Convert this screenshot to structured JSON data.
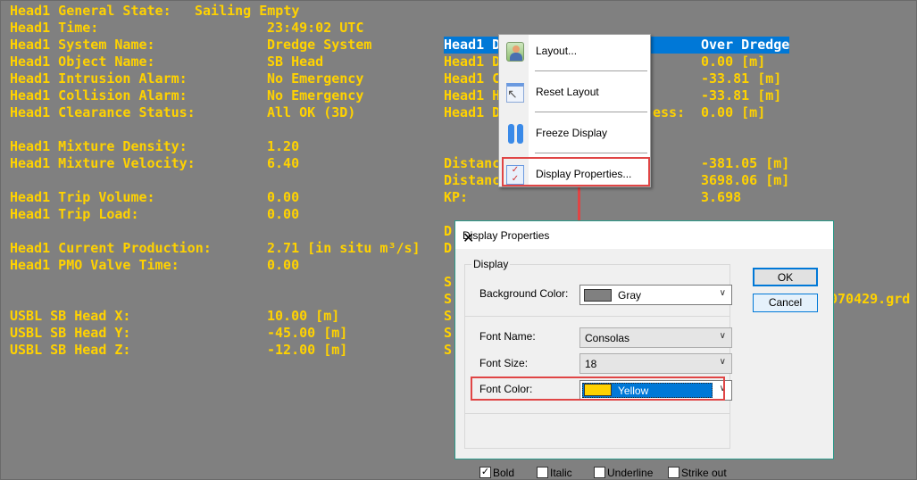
{
  "left_rows": [
    {
      "label": "Head1 General State:",
      "value": "Sailing Empty",
      "row": 0,
      "vcol": "near"
    },
    {
      "label": "Head1 Time:",
      "value": "23:49:02 UTC",
      "row": 1
    },
    {
      "label": "Head1 System Name:",
      "value": "Dredge System",
      "row": 2
    },
    {
      "label": "Head1 Object Name:",
      "value": "SB Head",
      "row": 3
    },
    {
      "label": "Head1 Intrusion Alarm:",
      "value": "No Emergency",
      "row": 4
    },
    {
      "label": "Head1 Collision Alarm:",
      "value": "No Emergency",
      "row": 5
    },
    {
      "label": "Head1 Clearance Status:",
      "value": "All OK (3D)",
      "row": 6
    },
    {
      "label": "Head1 Mixture Density:",
      "value": "1.20",
      "row": 8
    },
    {
      "label": "Head1 Mixture Velocity:",
      "value": "6.40",
      "row": 9
    },
    {
      "label": "Head1 Trip Volume:",
      "value": "0.00",
      "row": 11
    },
    {
      "label": "Head1 Trip Load:",
      "value": "0.00",
      "row": 12
    },
    {
      "label": "Head1 Current Production:",
      "value": "2.71 [in situ m³/s]",
      "row": 14
    },
    {
      "label": "Head1 PMO Valve Time:",
      "value": "0.00",
      "row": 15
    },
    {
      "label": "USBL SB Head X:",
      "value": "10.00 [m]",
      "row": 18
    },
    {
      "label": "USBL SB Head Y:",
      "value": "-45.00 [m]",
      "row": 19
    },
    {
      "label": "USBL SB Head Z:",
      "value": "-12.00 [m]",
      "row": 20
    }
  ],
  "right_rows": [
    {
      "label": "Head1 D",
      "value": "Over Dredge",
      "row": 2
    },
    {
      "label": "Head1 D",
      "value": "0.00 [m]",
      "row": 3
    },
    {
      "label": "Head1 C",
      "value": "-33.81 [m]",
      "row": 4
    },
    {
      "label": "Head1 H",
      "value": "-33.81 [m]",
      "row": 5
    },
    {
      "label": "Head1 D",
      "value": "0.00 [m]",
      "row": 6,
      "tail": "ess:"
    },
    {
      "label": "Distanc",
      "value": "-381.05 [m]",
      "row": 9
    },
    {
      "label": "Distanc",
      "value": "3698.06 [m]",
      "row": 10
    },
    {
      "label": "KP:",
      "value": "3.698",
      "row": 11
    },
    {
      "label": "D",
      "value": "",
      "row": 13
    },
    {
      "label": "D",
      "value": "",
      "row": 14
    },
    {
      "label": "S",
      "value": "",
      "row": 16
    },
    {
      "label": "S",
      "value": "070429.grd",
      "row": 17
    },
    {
      "label": "S",
      "value": "",
      "row": 18
    },
    {
      "label": "S",
      "value": "",
      "row": 19
    },
    {
      "label": "S",
      "value": "",
      "row": 20
    }
  ],
  "context_menu": {
    "items": [
      {
        "label": "Layout...",
        "icon": "layout-user-icon"
      },
      {
        "label": "Reset Layout",
        "icon": "reset-layout-cursor-icon"
      },
      {
        "label": "Freeze Display",
        "icon": "pause-icon"
      },
      {
        "label": "Display Properties...",
        "icon": "checklist-icon"
      }
    ]
  },
  "dialog": {
    "title": "Display Properties",
    "group": "Display",
    "background_color_label": "Background Color:",
    "background_color_value": "Gray",
    "font_name_label": "Font Name:",
    "font_name_value": "Consolas",
    "font_size_label": "Font Size:",
    "font_size_value": "18",
    "font_color_label": "Font Color:",
    "font_color_value": "Yellow",
    "checkboxes": [
      {
        "label": "Bold",
        "checked": true
      },
      {
        "label": "Italic",
        "checked": false
      },
      {
        "label": "Underline",
        "checked": false
      },
      {
        "label": "Strike out",
        "checked": false
      }
    ],
    "ok_label": "OK",
    "cancel_label": "Cancel"
  },
  "colors": {
    "background": "#808080",
    "font": "#FFD200",
    "highlight": "#0078D7",
    "annotation": "#E04545"
  }
}
